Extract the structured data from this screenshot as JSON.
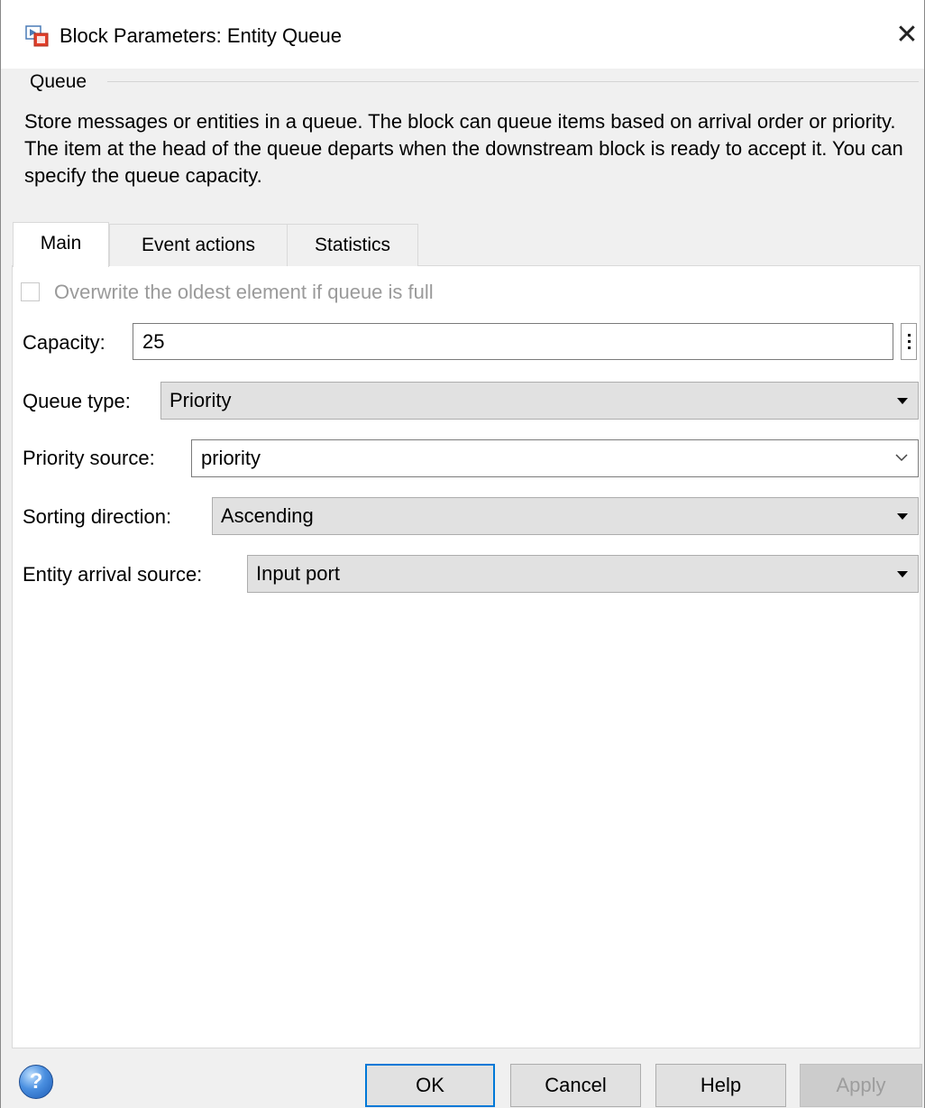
{
  "window": {
    "title": "Block Parameters: Entity Queue"
  },
  "group": {
    "title": "Queue",
    "description": "Store messages or entities in a queue. The block can queue items based on arrival order or priority. The item at the head of the queue departs when the downstream block is ready to accept it. You can specify the queue capacity."
  },
  "tabs": [
    {
      "label": "Main",
      "active": true
    },
    {
      "label": "Event actions",
      "active": false
    },
    {
      "label": "Statistics",
      "active": false
    }
  ],
  "main": {
    "overwrite_checkbox": {
      "label": "Overwrite the oldest element if queue is full",
      "checked": false,
      "enabled": false
    },
    "capacity": {
      "label": "Capacity:",
      "value": "25"
    },
    "queue_type": {
      "label": "Queue type:",
      "value": "Priority"
    },
    "priority_source": {
      "label": "Priority source:",
      "value": "priority"
    },
    "sorting_direction": {
      "label": "Sorting direction:",
      "value": "Ascending"
    },
    "entity_arrival_source": {
      "label": "Entity arrival source:",
      "value": "Input port"
    }
  },
  "footer": {
    "ok_label": "OK",
    "cancel_label": "Cancel",
    "help_label": "Help",
    "apply_label": "Apply",
    "help_icon_glyph": "?"
  },
  "colors": {
    "default_button_border": "#0078d7",
    "disabled_text": "#9d9d9d"
  }
}
